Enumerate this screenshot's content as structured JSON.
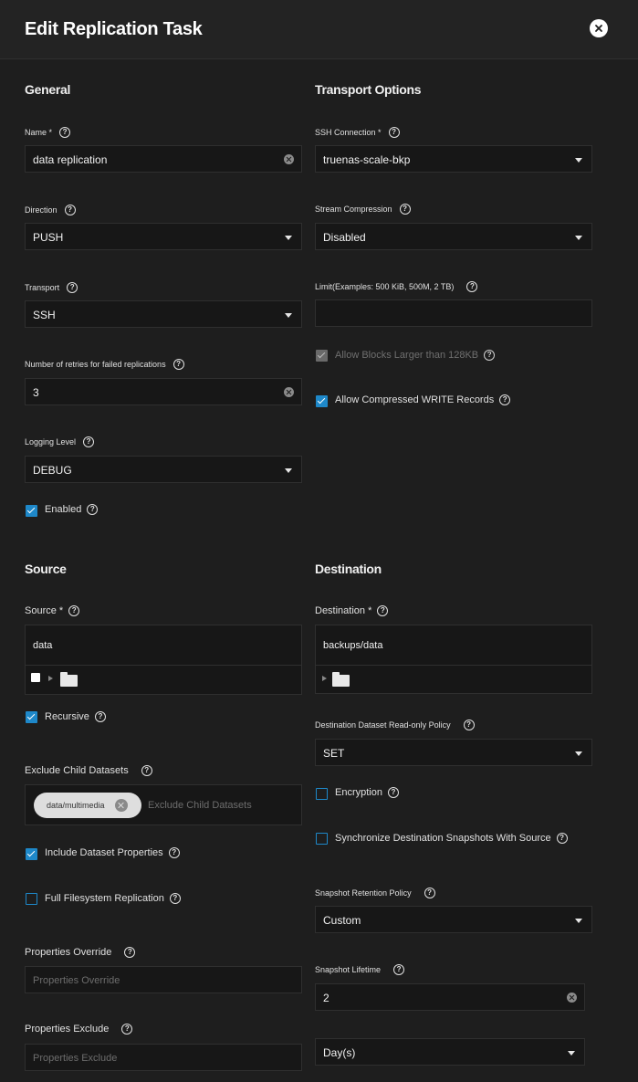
{
  "dialog": {
    "title": "Edit Replication Task"
  },
  "general": {
    "title": "General",
    "name": {
      "label": "Name *",
      "value": "data replication"
    },
    "direction": {
      "label": "Direction",
      "value": "PUSH"
    },
    "transport": {
      "label": "Transport",
      "value": "SSH"
    },
    "retries": {
      "label": "Number of retries for failed replications",
      "value": "3"
    },
    "logging": {
      "label": "Logging Level",
      "value": "DEBUG"
    },
    "enabled": {
      "label": "Enabled",
      "checked": true
    }
  },
  "transport_options": {
    "title": "Transport Options",
    "ssh": {
      "label": "SSH Connection *",
      "value": "truenas-scale-bkp"
    },
    "compression": {
      "label": "Stream Compression",
      "value": "Disabled"
    },
    "limit": {
      "label": "Limit(Examples: 500 KiB, 500M, 2 TB)",
      "value": ""
    },
    "large_blocks": {
      "label": "Allow Blocks Larger than 128KB",
      "checked": true,
      "disabled": true
    },
    "compressed_write": {
      "label": "Allow Compressed WRITE Records",
      "checked": true
    }
  },
  "source": {
    "title": "Source",
    "label": "Source *",
    "value": "data",
    "recursive": {
      "label": "Recursive",
      "checked": true
    },
    "exclude": {
      "label": "Exclude Child Datasets",
      "chip": "data/multimedia",
      "placeholder": "Exclude Child Datasets"
    },
    "include_props": {
      "label": "Include Dataset Properties",
      "checked": true
    },
    "full_fs": {
      "label": "Full Filesystem Replication",
      "checked": false
    },
    "props_override": {
      "label": "Properties Override",
      "placeholder": "Properties Override"
    },
    "props_exclude": {
      "label": "Properties Exclude",
      "placeholder": "Properties Exclude"
    }
  },
  "destination": {
    "title": "Destination",
    "label": "Destination *",
    "value": "backups/data",
    "readonly": {
      "label": "Destination Dataset Read-only Policy",
      "value": "SET"
    },
    "encryption": {
      "label": "Encryption",
      "checked": false
    },
    "sync_snapshots": {
      "label": "Synchronize Destination Snapshots With Source",
      "checked": false
    },
    "retention": {
      "label": "Snapshot Retention Policy",
      "value": "Custom"
    },
    "lifetime": {
      "label": "Snapshot Lifetime",
      "value": "2",
      "unit": "Day(s)"
    }
  },
  "colors": {
    "accent": "#1e88c9",
    "background": "#1e1e1e",
    "field": "#171717"
  },
  "icons": [
    "close-icon",
    "help-icon",
    "dropdown-arrow-icon",
    "clear-icon",
    "folder-icon",
    "expand-icon",
    "checkbox-icon"
  ]
}
